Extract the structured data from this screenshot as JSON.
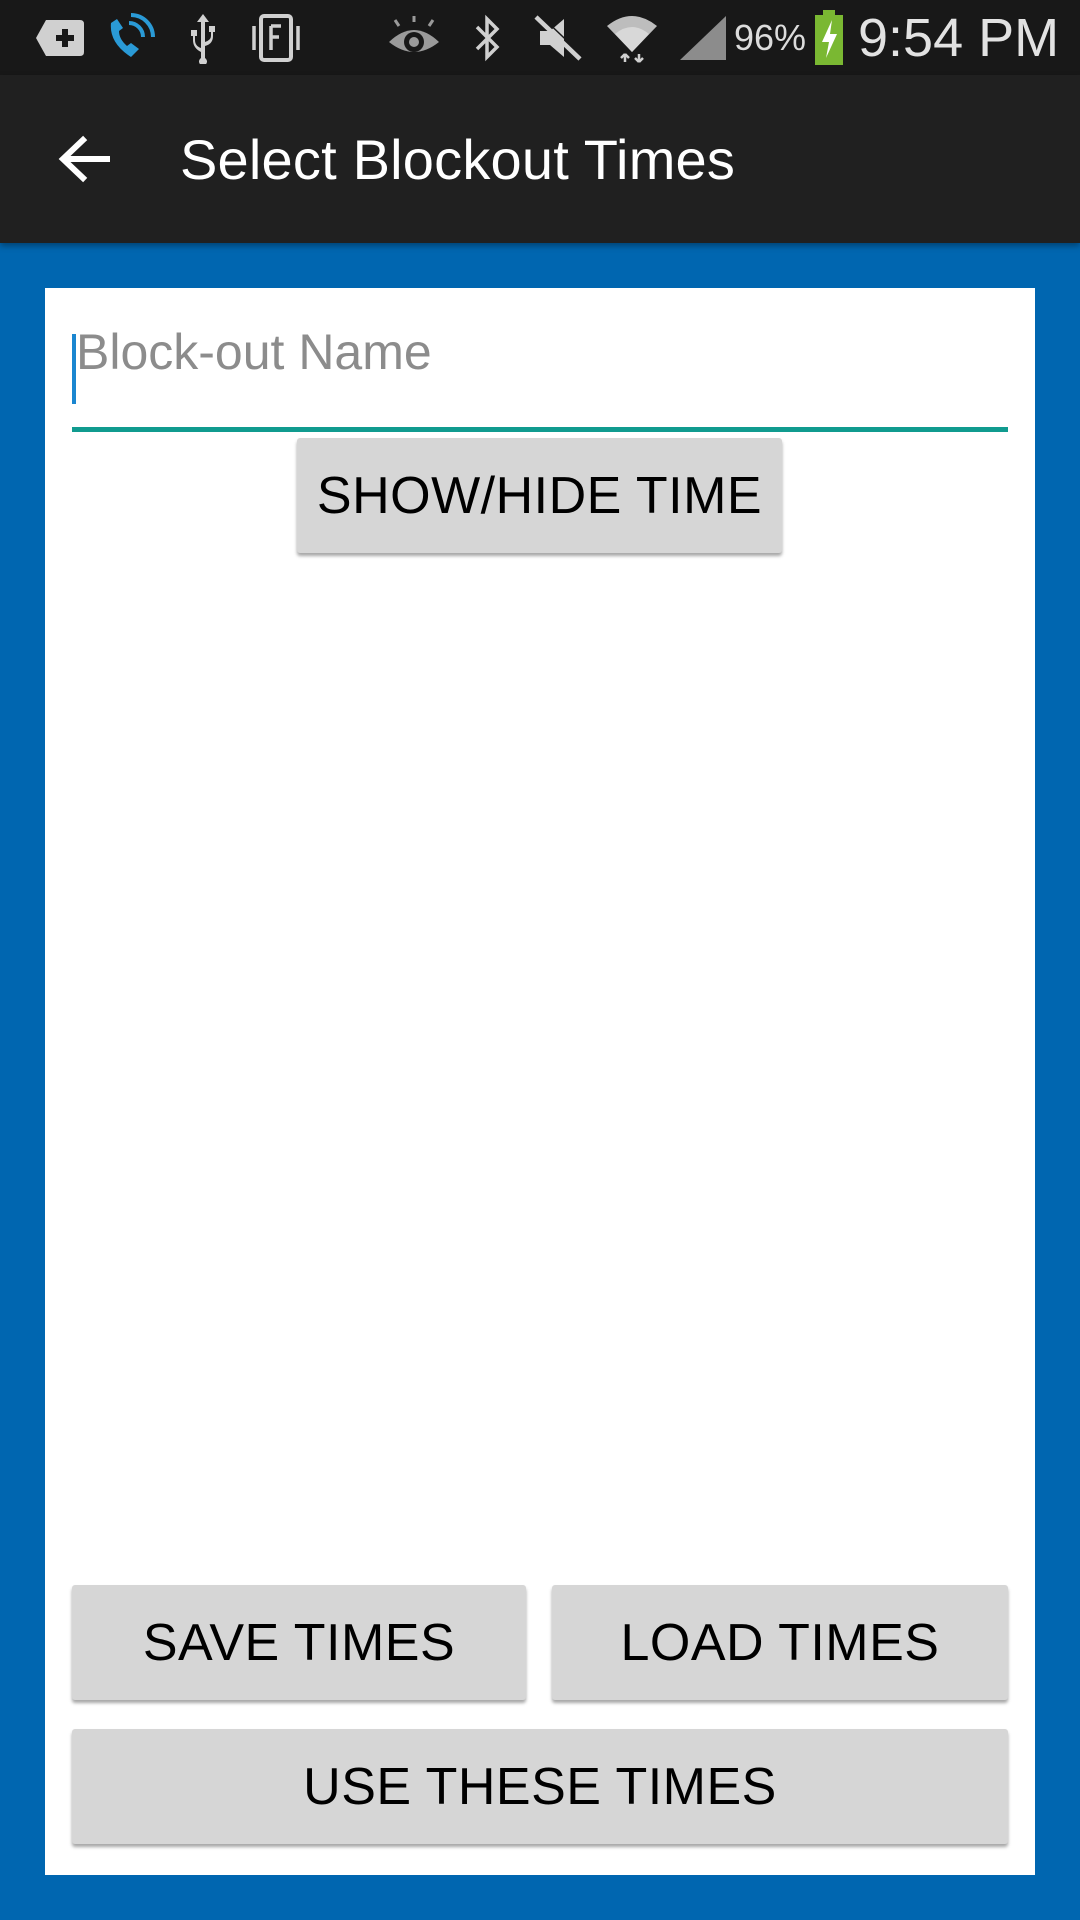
{
  "status_bar": {
    "battery_percent": "96%",
    "time": "9:54 PM",
    "icons": [
      "plus-box-icon",
      "wifi-call-icon",
      "usb-icon",
      "vibrate-f-icon",
      "eye-icon",
      "bluetooth-icon",
      "mute-icon",
      "wifi-icon",
      "signal-icon",
      "battery-charging-icon"
    ]
  },
  "toolbar": {
    "title": "Select Blockout Times",
    "back_icon": "arrow-back-icon"
  },
  "form": {
    "name_placeholder": "Block-out Name",
    "name_value": ""
  },
  "buttons": {
    "show_hide": "SHOW/HIDE TIME",
    "save": "SAVE TIMES",
    "load": "LOAD TIMES",
    "use": "USE THESE TIMES"
  },
  "colors": {
    "background": "#0066b0",
    "toolbar": "#202020",
    "status_bar": "#181818",
    "input_underline": "#109b8f",
    "button": "#d6d6d6",
    "battery": "#7ab832"
  }
}
